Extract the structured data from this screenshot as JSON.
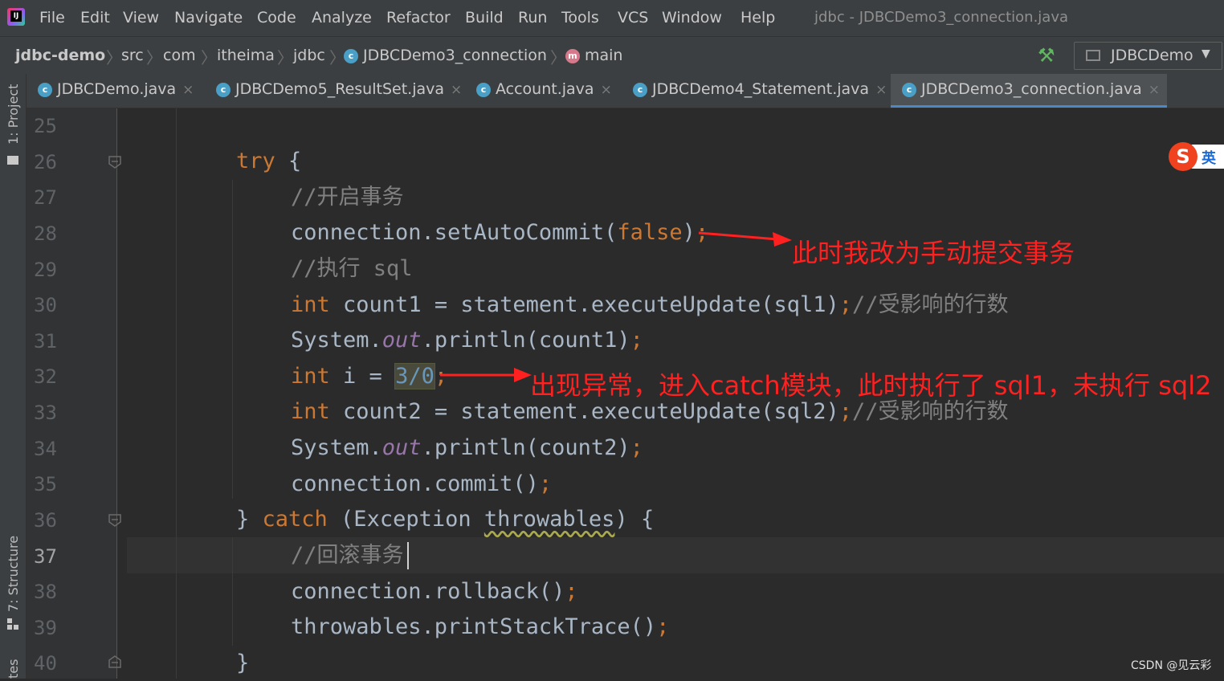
{
  "menu": {
    "items": [
      "File",
      "Edit",
      "View",
      "Navigate",
      "Code",
      "Analyze",
      "Refactor",
      "Build",
      "Run",
      "Tools",
      "VCS",
      "Window",
      "Help"
    ],
    "window_title": "jdbc - JDBCDemo3_connection.java"
  },
  "breadcrumb": {
    "items": [
      "jdbc-demo",
      "src",
      "com",
      "itheima",
      "jdbc",
      "JDBCDemo3_connection",
      "main"
    ]
  },
  "run_config": {
    "label": "JDBCDemo"
  },
  "tool_windows": {
    "project": "1: Project",
    "structure": "7: Structure",
    "favorites": "tes"
  },
  "tabs": [
    {
      "label": "JDBCDemo.java",
      "active": false
    },
    {
      "label": "JDBCDemo5_ResultSet.java",
      "active": false
    },
    {
      "label": "Account.java",
      "active": false
    },
    {
      "label": "JDBCDemo4_Statement.java",
      "active": false
    },
    {
      "label": "JDBCDemo3_connection.java",
      "active": true
    }
  ],
  "editor": {
    "current_line": 37,
    "lines": [
      {
        "no": "25"
      },
      {
        "no": "26"
      },
      {
        "no": "27"
      },
      {
        "no": "28"
      },
      {
        "no": "29"
      },
      {
        "no": "30"
      },
      {
        "no": "31"
      },
      {
        "no": "32"
      },
      {
        "no": "33"
      },
      {
        "no": "34"
      },
      {
        "no": "35"
      },
      {
        "no": "36"
      },
      {
        "no": "37"
      },
      {
        "no": "38"
      },
      {
        "no": "39"
      },
      {
        "no": "40"
      }
    ],
    "code": {
      "l26_kw": "try",
      "l26_rest": " {",
      "l27": "//开启事务",
      "l28_a": "connection.setAutoCommit(",
      "l28_kw": "false",
      "l28_b": ")",
      "l28_semi": ";",
      "l29": "//执行 sql",
      "l30_kw": "int",
      "l30_a": " count1 = statement.executeUpdate(sql1)",
      "l30_semi": ";",
      "l30_cmt": "//受影响的行数",
      "l31_a": "System.",
      "l31_fld": "out",
      "l31_b": ".println(count1)",
      "l31_semi": ";",
      "l32_kw": "int",
      "l32_a": " i = ",
      "l32_num": "3/0",
      "l32_semi": ";",
      "l33_kw": "int",
      "l33_a": " count2 = statement.executeUpdate(sql2)",
      "l33_semi": ";",
      "l33_cmt": "//受影响的行数",
      "l34_a": "System.",
      "l34_fld": "out",
      "l34_b": ".println(count2)",
      "l34_semi": ";",
      "l35_a": "connection.commit()",
      "l35_semi": ";",
      "l36_a": "} ",
      "l36_kw": "catch",
      "l36_b": " (Exception ",
      "l36_warn": "throwables",
      "l36_c": ") {",
      "l37": "//回滚事务",
      "l38_a": "connection.rollback()",
      "l38_semi": ";",
      "l39_a": "throwables.printStackTrace()",
      "l39_semi": ";",
      "l40": "}"
    }
  },
  "annotations": {
    "first": "此时我改为手动提交事务",
    "second": "出现异常，进入catch模块，此时执行了 sql1，未执行 sql2",
    "color": "#ff2020"
  },
  "ime": {
    "logo": "S",
    "label": "英"
  },
  "watermark": "CSDN @见云彩",
  "colors": {
    "keyword": "#cc7832",
    "comment": "#808080",
    "field": "#9876aa",
    "number": "#6897bb",
    "text": "#a9b7c6",
    "tab_underline": "#4a88c7"
  }
}
